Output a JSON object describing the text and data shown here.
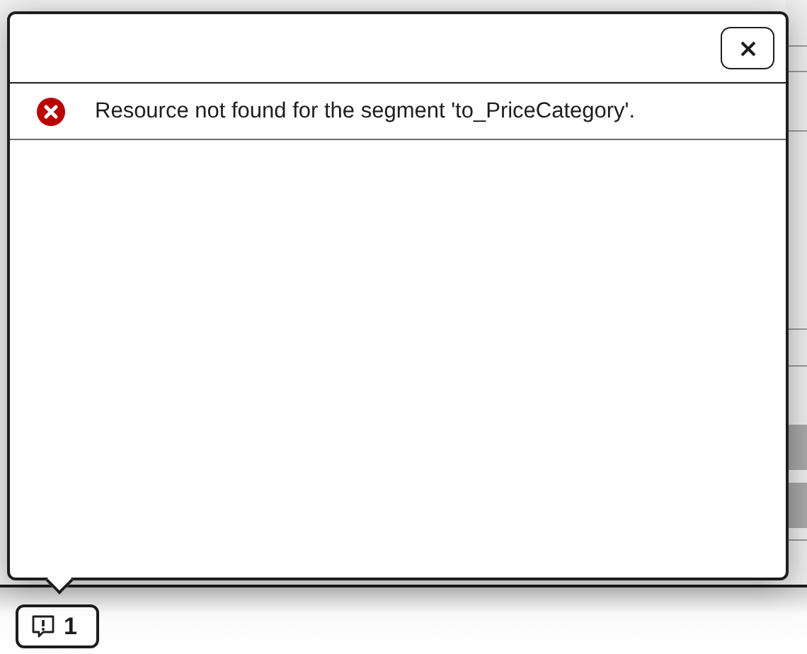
{
  "message_popover": {
    "messages": [
      {
        "kind": "error",
        "text": "Resource not found for the segment 'to_PriceCategory'."
      }
    ]
  },
  "footer": {
    "message_button": {
      "count": "1"
    }
  }
}
